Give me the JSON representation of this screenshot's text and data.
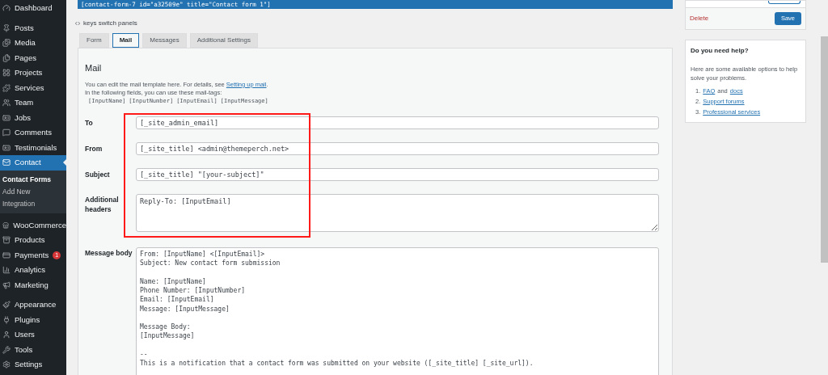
{
  "sidebar": {
    "sections": [
      {
        "items": [
          {
            "label": "Dashboard",
            "selected": false
          }
        ]
      },
      {
        "items": [
          {
            "label": "Posts",
            "selected": false
          },
          {
            "label": "Media",
            "selected": false
          },
          {
            "label": "Pages",
            "selected": false
          },
          {
            "label": "Projects",
            "selected": false
          },
          {
            "label": "Services",
            "selected": false
          },
          {
            "label": "Team",
            "selected": false
          },
          {
            "label": "Jobs",
            "selected": false
          },
          {
            "label": "Comments",
            "selected": false
          },
          {
            "label": "Testimonials",
            "selected": false
          },
          {
            "label": "Contact",
            "selected": true,
            "children": [
              {
                "label": "Contact Forms",
                "selected": true
              },
              {
                "label": "Add New",
                "selected": false
              },
              {
                "label": "Integration",
                "selected": false
              }
            ]
          }
        ]
      },
      {
        "items": [
          {
            "label": "WooCommerce",
            "selected": false
          },
          {
            "label": "Products",
            "selected": false
          },
          {
            "label": "Payments",
            "selected": false,
            "badge": "1"
          },
          {
            "label": "Analytics",
            "selected": false
          },
          {
            "label": "Marketing",
            "selected": false
          }
        ]
      },
      {
        "items": [
          {
            "label": "Appearance",
            "selected": false
          },
          {
            "label": "Plugins",
            "selected": false
          },
          {
            "label": "Users",
            "selected": false
          },
          {
            "label": "Tools",
            "selected": false
          },
          {
            "label": "Settings",
            "selected": false
          }
        ]
      }
    ]
  },
  "shortcode": "[contact-form-7 id=\"a32509e\" title=\"Contact form 1\"]",
  "keys_hint": "keys switch panels",
  "tabs": [
    {
      "label": "Form",
      "selected": false
    },
    {
      "label": "Mail",
      "selected": true
    },
    {
      "label": "Messages",
      "selected": false
    },
    {
      "label": "Additional Settings",
      "selected": false
    }
  ],
  "mail": {
    "heading": "Mail",
    "intro": "You can edit the mail template here. For details, see",
    "intro_link": "Setting up mail",
    "intro_end": ".",
    "tags_intro": "In the following fields, you can use these mail-tags:",
    "tags": [
      "[InputName]",
      "[InputNumber]",
      "[InputEmail]",
      "[InputMessage]"
    ],
    "fields": [
      {
        "label": "To",
        "kind": "input",
        "value": "[_site_admin_email]"
      },
      {
        "label": "From",
        "kind": "input",
        "value": "[_site_title] <admin@themeperch.net>"
      },
      {
        "label": "Subject",
        "kind": "input",
        "value": "[_site_title] \"[your-subject]\""
      },
      {
        "label": "Additional headers",
        "kind": "textarea",
        "value": "Reply-To: [InputEmail]"
      },
      {
        "label": "Message body",
        "kind": "body",
        "value": "From: [InputName] <[InputEmail]>\nSubject: New contact form submission\n\nName: [InputName]\nPhone Number: [InputNumber]\nEmail: [InputEmail]\nMessage: [InputMessage]\n\nMessage Body:\n[InputMessage]\n\n--\nThis is a notification that a contact form was submitted on your website ([_site_title] [_site_url])."
      }
    ]
  },
  "status_box": {
    "delete": "Delete",
    "save": "Save"
  },
  "help": {
    "title": "Do you need help?",
    "text": "Here are some available options to help solve your problems.",
    "items": [
      {
        "number": "1.",
        "parts": [
          {
            "kind": "link",
            "text": "FAQ"
          },
          {
            "kind": "text",
            "text": "and"
          },
          {
            "kind": "link",
            "text": "docs"
          }
        ]
      },
      {
        "number": "2.",
        "parts": [
          {
            "kind": "link",
            "text": "Support forums"
          }
        ]
      },
      {
        "number": "3.",
        "parts": [
          {
            "kind": "link",
            "text": "Professional services"
          }
        ]
      }
    ]
  }
}
